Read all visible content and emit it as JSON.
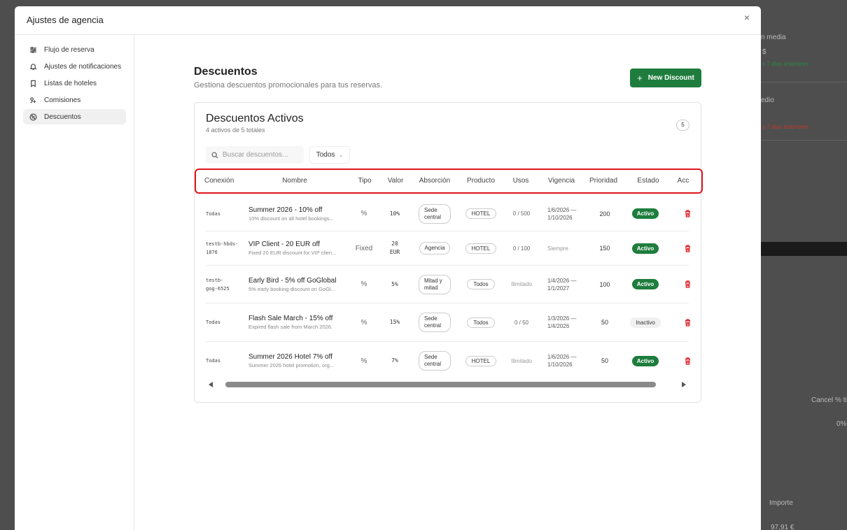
{
  "modal": {
    "title": "Ajustes de agencia",
    "close": "×"
  },
  "sidebar": {
    "items": [
      {
        "label": "Flujo de reserva",
        "icon": "sliders-icon"
      },
      {
        "label": "Ajustes de notificaciones",
        "icon": "bell-icon"
      },
      {
        "label": "Listas de hoteles",
        "icon": "bookmark-icon"
      },
      {
        "label": "Comisiones",
        "icon": "commission-icon"
      },
      {
        "label": "Descuentos",
        "icon": "discount-icon",
        "active": true
      }
    ]
  },
  "page": {
    "title": "Descuentos",
    "subtitle": "Gestiona descuentos promocionales para tus reservas.",
    "new_button": "New Discount"
  },
  "card": {
    "title": "Descuentos Activos",
    "subtitle": "4 activos de 5 totales",
    "count": "5",
    "search_placeholder": "Buscar descuentos...",
    "filter_value": "Todos"
  },
  "table": {
    "headers": [
      "Conexión",
      "Nombre",
      "Tipo",
      "Valor",
      "Absorción",
      "Producto",
      "Usos",
      "Vigencia",
      "Prioridad",
      "Estado",
      "Acc"
    ],
    "rows": [
      {
        "conexion": "Todas",
        "nombre": "Summer 2026 - 10% off",
        "descripcion": "10% discount on all hotel bookings...",
        "tipo": "%",
        "valor": "10%",
        "absorcion": "Sede central",
        "producto": "HOTEL",
        "usos": "0 / 500",
        "vigencia": "1/6/2026 — 1/10/2026",
        "prioridad": "200",
        "estado": "Activo",
        "activo": true
      },
      {
        "conexion": "testb-hbds-1876",
        "nombre": "VIP Client - 20 EUR off",
        "descripcion": "Fixed 20 EUR discount for VIP clien...",
        "tipo": "Fixed",
        "valor": "20 EUR",
        "absorcion": "Agencia",
        "producto": "HOTEL",
        "usos": "0 / 100",
        "vigencia": "Siempre",
        "prioridad": "150",
        "estado": "Activo",
        "activo": true
      },
      {
        "conexion": "testb-gog-6525",
        "nombre": "Early Bird - 5% off GoGlobal",
        "descripcion": "5% early booking discount on GoGl...",
        "tipo": "%",
        "valor": "5%",
        "absorcion": "Mitad y mitad",
        "producto": "Todos",
        "usos": "Ilimitado",
        "vigencia": "1/4/2026 — 1/1/2027",
        "prioridad": "100",
        "estado": "Activo",
        "activo": true
      },
      {
        "conexion": "Todas",
        "nombre": "Flash Sale March - 15% off",
        "descripcion": "Expired flash sale from March 2026.",
        "tipo": "%",
        "valor": "15%",
        "absorcion": "Sede central",
        "producto": "Todos",
        "usos": "0 / 50",
        "vigencia": "1/3/2026 — 1/4/2026",
        "prioridad": "50",
        "estado": "Inactivo",
        "activo": false
      },
      {
        "conexion": "Todas",
        "nombre": "Summer 2026 Hotel 7% off",
        "descripcion": "Summer 2026 hotel promotion, org...",
        "tipo": "%",
        "valor": "7%",
        "absorcion": "Sede central",
        "producto": "HOTEL",
        "usos": "Ilimitado",
        "vigencia": "1/6/2026 — 1/10/2026",
        "prioridad": "50",
        "estado": "Activo",
        "activo": true
      }
    ]
  },
  "background": {
    "texts": [
      "n media",
      "$",
      "s 7 días anteriores",
      "edio",
      "s 7 días anteriores",
      "Cancel % ti",
      "0%",
      "Importe",
      "97,91 €"
    ]
  },
  "colors": {
    "accent": "#1e7d3d",
    "danger": "#e0141b",
    "highlight": "#e0141b"
  }
}
